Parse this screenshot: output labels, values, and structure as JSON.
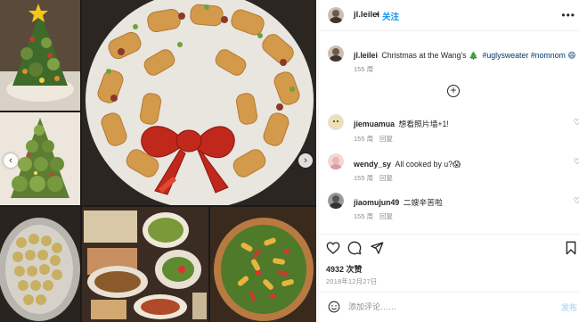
{
  "header": {
    "username": "jl.leilei",
    "separator": "•",
    "follow_label": "关注",
    "more_icon": "more-horizontal-icon"
  },
  "caption": {
    "username": "jl.leilei",
    "text": "Christmas at the Wang's 🎄",
    "tags": "#uglysweater #nomnom 😄",
    "time": "155 周"
  },
  "load_more_icon": "plus-circle-icon",
  "comments": [
    {
      "username": "jiemuamua",
      "text": "想看照片墙+1!",
      "time": "155 周",
      "reply": "回复"
    },
    {
      "username": "wendy_sy",
      "text": "All cooked by u?😱",
      "time": "155 周",
      "reply": "回复"
    },
    {
      "username": "jiaomujun49",
      "text": "二嫂辛苦啦",
      "time": "155 周",
      "reply": "回复"
    }
  ],
  "actions": {
    "like_icon": "heart-icon",
    "comment_icon": "comment-icon",
    "share_icon": "send-icon",
    "save_icon": "bookmark-icon"
  },
  "likes_text": "4932 次赞",
  "date_text": "2018年12月27日",
  "comment_box": {
    "emoji_icon": "smiley-icon",
    "placeholder": "添加评论……",
    "post_label": "发布"
  },
  "carousel": {
    "prev_icon": "chevron-left-icon",
    "next_icon": "chevron-right-icon"
  },
  "colors": {
    "link_blue": "#0095f6",
    "hashtag": "#00376b",
    "muted": "#8e8e8e",
    "post_disabled": "#b2dffc"
  }
}
